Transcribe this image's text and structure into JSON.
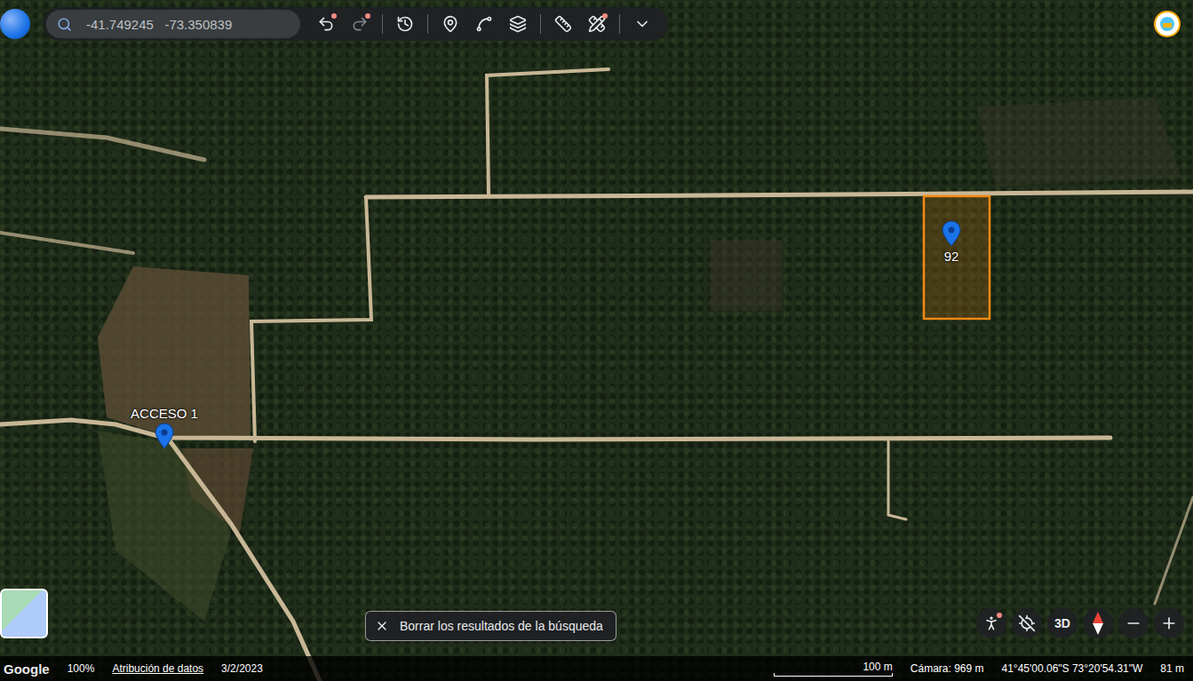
{
  "search": {
    "value": "-41.749245   -73.350839"
  },
  "toolbar": [
    {
      "name": "undo",
      "badge": true,
      "disabled": false
    },
    {
      "name": "redo",
      "badge": true,
      "disabled": true
    },
    {
      "name": "history",
      "badge": false,
      "disabled": false
    },
    {
      "name": "placemark",
      "badge": false,
      "disabled": false
    },
    {
      "name": "path",
      "badge": false,
      "disabled": false
    },
    {
      "name": "layers",
      "badge": false,
      "disabled": false
    },
    {
      "name": "measure",
      "badge": false,
      "disabled": false
    },
    {
      "name": "tools",
      "badge": true,
      "disabled": false
    },
    {
      "name": "more",
      "badge": false,
      "disabled": false
    }
  ],
  "pins": [
    {
      "label": "ACCESO 1",
      "label_position": "above"
    },
    {
      "label": "92",
      "label_position": "below"
    }
  ],
  "clear_search": {
    "label": "Borrar los resultados de la búsqueda"
  },
  "map_controls": [
    {
      "name": "street-view",
      "text": "",
      "badge": true
    },
    {
      "name": "tilt",
      "text": "",
      "badge": false
    },
    {
      "name": "3d",
      "text": "3D",
      "badge": false
    },
    {
      "name": "compass",
      "text": "",
      "badge": false
    },
    {
      "name": "zoom-out",
      "text": "",
      "badge": false
    },
    {
      "name": "zoom-in",
      "text": "",
      "badge": false
    }
  ],
  "status_bar": {
    "brand": "Google",
    "zoom": "100%",
    "attribution": "Atribución de datos",
    "date": "3/2/2023",
    "scale": "100 m",
    "camera": "Cámara: 969 m",
    "coordinates": "41°45'00.06\"S 73°20'54.31\"W",
    "elevation": "81 m"
  }
}
